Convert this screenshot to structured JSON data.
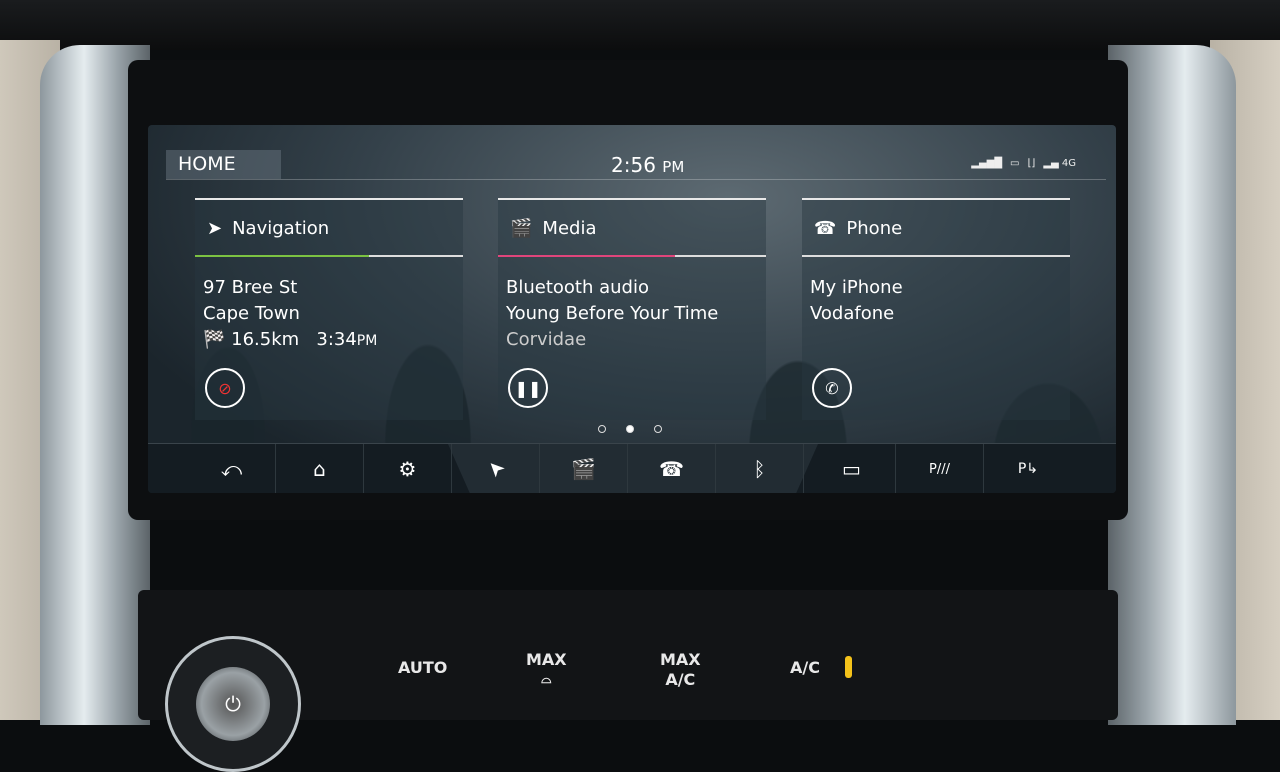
{
  "status": {
    "home_label": "HOME",
    "time": "2:56",
    "ampm": "PM",
    "network": "4G",
    "icons": [
      "signal-icon",
      "battery-icon",
      "seat-icon",
      "signal-4g-icon"
    ]
  },
  "cards": [
    {
      "title": "Navigation",
      "icon": "navigation-arrow-icon",
      "accent": "#7cc242",
      "progress": 0.65,
      "lines": [
        "97 Bree St",
        "Cape Town"
      ],
      "distance": "16.5km",
      "eta": "3:34",
      "eta_ampm": "PM",
      "button_icon": "cancel-route-icon"
    },
    {
      "title": "Media",
      "icon": "media-clapper-icon",
      "accent": "#e0457b",
      "progress": 0.66,
      "lines": [
        "Bluetooth audio",
        "Young Before Your Time",
        "Corvidae"
      ],
      "button_icon": "pause-icon"
    },
    {
      "title": "Phone",
      "icon": "phone-icon",
      "accent": "#dddddd",
      "progress": 0,
      "lines": [
        "My iPhone",
        "Vodafone"
      ],
      "button_icon": "call-icon"
    }
  ],
  "pager": {
    "pages": 3,
    "current": 2
  },
  "dock": [
    {
      "name": "back",
      "glyph": "⤺"
    },
    {
      "name": "home",
      "glyph": "⌂"
    },
    {
      "name": "settings",
      "glyph": "⚙"
    },
    {
      "name": "navigation",
      "glyph": "➤"
    },
    {
      "name": "media",
      "glyph": "🎬"
    },
    {
      "name": "phone",
      "glyph": "☎"
    },
    {
      "name": "bluetooth",
      "glyph": "ᛒ"
    },
    {
      "name": "camera",
      "glyph": "▭"
    },
    {
      "name": "park-distance",
      "glyph": "P///"
    },
    {
      "name": "park-assist",
      "glyph": "P↳"
    }
  ],
  "climate": {
    "auto": "AUTO",
    "max_defrost": "MAX",
    "max_ac_top": "MAX",
    "max_ac_bottom": "A/C",
    "ac": "A/C",
    "ac_indicator_color": "#f4c21a"
  }
}
